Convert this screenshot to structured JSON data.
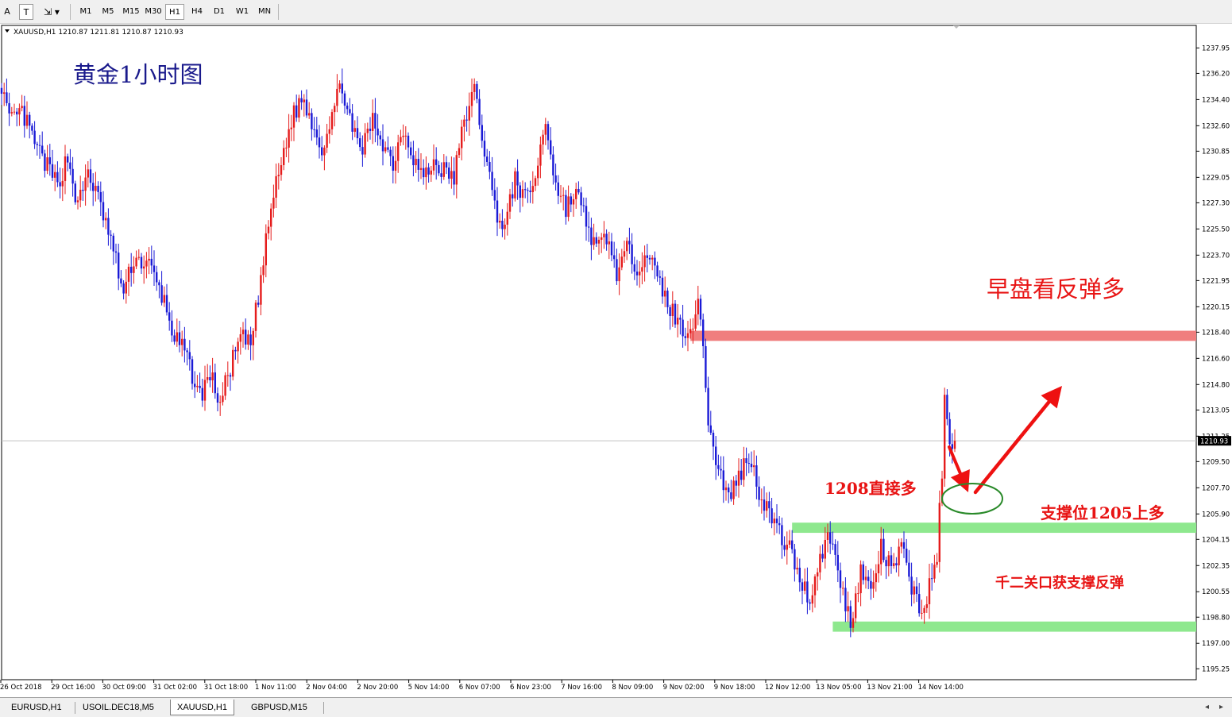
{
  "toolbar": {
    "tools": [
      "A",
      "T"
    ],
    "timeframes": [
      "M1",
      "M5",
      "M15",
      "M30",
      "H1",
      "H4",
      "D1",
      "W1",
      "MN"
    ],
    "active_timeframe": "H1"
  },
  "chart_data": {
    "type": "candlestick",
    "header": "XAUUSD,H1  1210.87 1211.81 1210.87 1210.93",
    "title": "黄金1小时图",
    "ylim": [
      1194.5,
      1239.5
    ],
    "y_ticks": [
      "1237.95",
      "1236.20",
      "1234.40",
      "1232.60",
      "1230.85",
      "1229.05",
      "1227.30",
      "1225.50",
      "1223.70",
      "1221.95",
      "1220.15",
      "1218.40",
      "1216.60",
      "1214.80",
      "1213.05",
      "1211.25",
      "1209.50",
      "1207.70",
      "1205.90",
      "1204.15",
      "1202.35",
      "1200.55",
      "1198.80",
      "1197.00",
      "1195.25"
    ],
    "current_price": "1210.93",
    "current_price_value": 1210.93,
    "x_ticks": [
      "26 Oct 2018",
      "29 Oct 16:00",
      "30 Oct 09:00",
      "31 Oct 02:00",
      "31 Oct 18:00",
      "1 Nov 11:00",
      "2 Nov 04:00",
      "2 Nov 20:00",
      "5 Nov 14:00",
      "6 Nov 07:00",
      "6 Nov 23:00",
      "7 Nov 16:00",
      "8 Nov 09:00",
      "9 Nov 02:00",
      "9 Nov 18:00",
      "12 Nov 12:00",
      "13 Nov 05:00",
      "13 Nov 21:00",
      "14 Nov 14:00"
    ],
    "anchors": [
      [
        0,
        1235.5
      ],
      [
        3,
        1232.8
      ],
      [
        8,
        1233.5
      ],
      [
        14,
        1231.0
      ],
      [
        22,
        1228.5
      ],
      [
        26,
        1230.5
      ],
      [
        30,
        1227.0
      ],
      [
        34,
        1229.5
      ],
      [
        40,
        1226.5
      ],
      [
        44,
        1224.0
      ],
      [
        48,
        1221.0
      ],
      [
        52,
        1223.5
      ],
      [
        58,
        1223.0
      ],
      [
        64,
        1220.5
      ],
      [
        68,
        1218.0
      ],
      [
        72,
        1217.0
      ],
      [
        78,
        1214.0
      ],
      [
        82,
        1215.5
      ],
      [
        86,
        1213.5
      ],
      [
        90,
        1216.0
      ],
      [
        94,
        1218.0
      ],
      [
        98,
        1217.5
      ],
      [
        102,
        1222.0
      ],
      [
        106,
        1227.0
      ],
      [
        110,
        1230.0
      ],
      [
        114,
        1233.0
      ],
      [
        118,
        1234.5
      ],
      [
        122,
        1233.0
      ],
      [
        126,
        1231.0
      ],
      [
        130,
        1233.5
      ],
      [
        134,
        1235.5
      ],
      [
        138,
        1232.0
      ],
      [
        142,
        1231.0
      ],
      [
        146,
        1233.0
      ],
      [
        150,
        1231.5
      ],
      [
        154,
        1230.0
      ],
      [
        158,
        1232.5
      ],
      [
        162,
        1230.5
      ],
      [
        166,
        1229.0
      ],
      [
        170,
        1230.0
      ],
      [
        174,
        1229.5
      ],
      [
        178,
        1229.0
      ],
      [
        182,
        1233.0
      ],
      [
        186,
        1235.0
      ],
      [
        190,
        1231.0
      ],
      [
        194,
        1227.0
      ],
      [
        198,
        1225.5
      ],
      [
        202,
        1229.0
      ],
      [
        206,
        1227.5
      ],
      [
        210,
        1229.0
      ],
      [
        214,
        1233.0
      ],
      [
        218,
        1228.5
      ],
      [
        222,
        1227.0
      ],
      [
        226,
        1228.0
      ],
      [
        230,
        1226.0
      ],
      [
        234,
        1224.0
      ],
      [
        238,
        1225.0
      ],
      [
        242,
        1222.5
      ],
      [
        246,
        1224.0
      ],
      [
        250,
        1223.0
      ],
      [
        254,
        1224.0
      ],
      [
        258,
        1222.0
      ],
      [
        262,
        1220.5
      ],
      [
        266,
        1219.0
      ],
      [
        270,
        1218.5
      ],
      [
        274,
        1220.0
      ],
      [
        276,
        1218.0
      ],
      [
        278,
        1212.0
      ],
      [
        282,
        1209.0
      ],
      [
        286,
        1207.0
      ],
      [
        290,
        1208.5
      ],
      [
        294,
        1210.0
      ],
      [
        298,
        1207.5
      ],
      [
        302,
        1206.0
      ],
      [
        306,
        1204.5
      ],
      [
        310,
        1203.5
      ],
      [
        314,
        1201.5
      ],
      [
        318,
        1200.0
      ],
      [
        322,
        1203.0
      ],
      [
        326,
        1204.5
      ],
      [
        330,
        1201.0
      ],
      [
        334,
        1198.5
      ],
      [
        338,
        1202.0
      ],
      [
        342,
        1200.5
      ],
      [
        346,
        1203.5
      ],
      [
        350,
        1202.0
      ],
      [
        354,
        1203.5
      ],
      [
        358,
        1201.0
      ],
      [
        362,
        1199.0
      ],
      [
        366,
        1201.5
      ],
      [
        368,
        1203.0
      ],
      [
        370,
        1209.0
      ],
      [
        371,
        1213.5
      ],
      [
        373,
        1211.0
      ],
      [
        375,
        1210.9
      ]
    ],
    "levels": [
      {
        "name": "resistance",
        "from_index": 271,
        "low": 1217.8,
        "high": 1218.5,
        "color": "#f07e7e"
      },
      {
        "name": "support-1205",
        "from_index": 311,
        "low": 1204.6,
        "high": 1205.3,
        "color": "#8ee88e"
      },
      {
        "name": "support-1198",
        "from_index": 327,
        "low": 1197.8,
        "high": 1198.5,
        "color": "#8ee88e"
      }
    ],
    "annotations": [
      {
        "text": "早盘看反弹多",
        "color": "#e81414"
      },
      {
        "text": "1208直接多",
        "color": "#e81414"
      },
      {
        "text": "支撑位1205上多",
        "color": "#e81414"
      },
      {
        "text": "千二关口获支撑反弹",
        "color": "#e81414"
      }
    ],
    "bull_color": "#e51c1c",
    "bear_color": "#1a1ad6",
    "title_color": "#1a1a8c"
  },
  "tabs": [
    "EURUSD,H1",
    "USOIL.DEC18,M5",
    "XAUUSD,H1",
    "GBPUSD,M15"
  ],
  "active_tab": "XAUUSD,H1"
}
